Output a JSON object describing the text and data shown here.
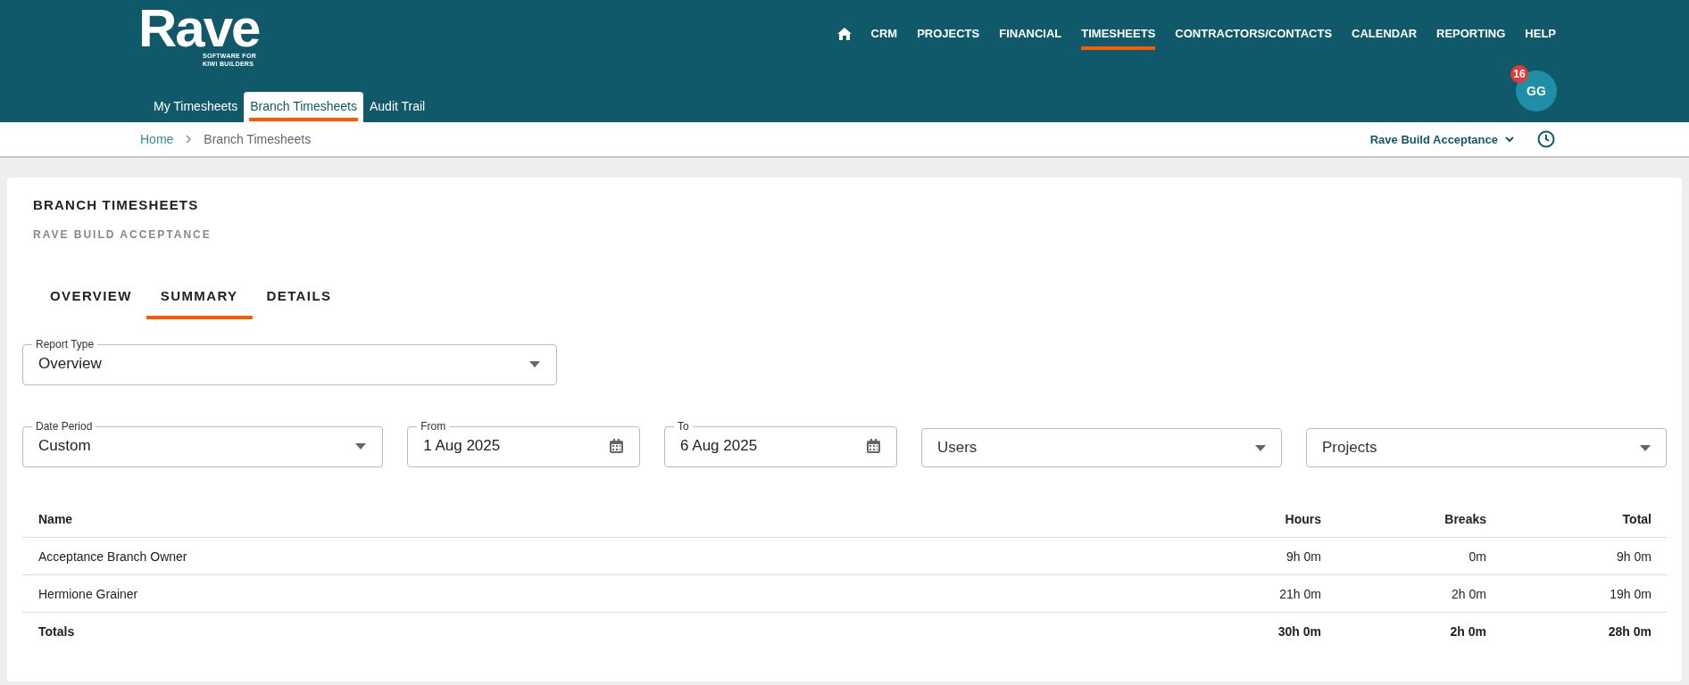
{
  "logo": {
    "wordmark": "Rave",
    "tagline": "SOFTWARE FOR KIWI BUILDERS"
  },
  "main_nav": [
    {
      "label": "CRM",
      "selected": false
    },
    {
      "label": "PROJECTS",
      "selected": false
    },
    {
      "label": "FINANCIAL",
      "selected": false
    },
    {
      "label": "TIMESHEETS",
      "selected": true
    },
    {
      "label": "CONTRACTORS/CONTACTS",
      "selected": false
    },
    {
      "label": "CALENDAR",
      "selected": false
    },
    {
      "label": "REPORTING",
      "selected": false
    },
    {
      "label": "HELP",
      "selected": false
    }
  ],
  "sub_nav": [
    {
      "label": "My Timesheets",
      "selected": false
    },
    {
      "label": "Branch Timesheets",
      "selected": true
    },
    {
      "label": "Audit Trail",
      "selected": false
    }
  ],
  "user": {
    "initials": "GG",
    "badge": "16"
  },
  "breadcrumb": [
    {
      "label": "Home",
      "kind": "link"
    },
    {
      "label": "Branch Timesheets",
      "kind": "current"
    }
  ],
  "company_selector": "Rave Build Acceptance",
  "page": {
    "title": "BRANCH TIMESHEETS",
    "subtitle": "RAVE BUILD ACCEPTANCE"
  },
  "tabs": [
    {
      "label": "OVERVIEW",
      "selected": false
    },
    {
      "label": "SUMMARY",
      "selected": true
    },
    {
      "label": "DETAILS",
      "selected": false
    }
  ],
  "filter_rows": [
    [
      {
        "kind": "select",
        "label": "Report Type",
        "value": "Overview"
      }
    ],
    [
      {
        "kind": "select",
        "label": "Date Period",
        "value": "Custom"
      },
      {
        "kind": "date",
        "label": "From",
        "value": "1 Aug 2025"
      },
      {
        "kind": "date",
        "label": "To",
        "value": "6 Aug 2025"
      },
      {
        "kind": "select",
        "placeholder": "Users"
      },
      {
        "kind": "select",
        "placeholder": "Projects"
      }
    ]
  ],
  "table": {
    "columns": [
      "Name",
      "Hours",
      "Breaks",
      "Total"
    ],
    "rows": [
      {
        "kind": "data",
        "cells": [
          "Acceptance Branch Owner",
          "9h 0m",
          "0m",
          "9h 0m"
        ]
      },
      {
        "kind": "data",
        "cells": [
          "Hermione Grainer",
          "21h 0m",
          "2h 0m",
          "19h 0m"
        ]
      },
      {
        "kind": "total",
        "cells": [
          "Totals",
          "30h 0m",
          "2h 0m",
          "28h 0m"
        ]
      }
    ]
  }
}
